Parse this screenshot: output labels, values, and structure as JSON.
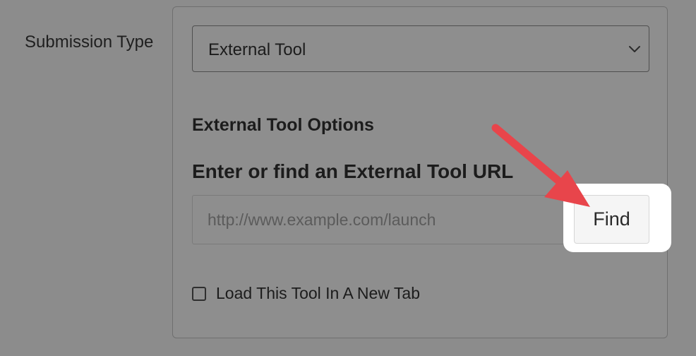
{
  "submission_type": {
    "label": "Submission Type",
    "selected": "External Tool"
  },
  "external_tool": {
    "options_heading": "External Tool Options",
    "url_heading": "Enter or find an External Tool URL",
    "url_placeholder": "http://www.example.com/launch",
    "url_value": "",
    "find_button": "Find",
    "new_tab_label": "Load This Tool In A New Tab",
    "new_tab_checked": false
  },
  "annotation": {
    "arrow_color": "#e8454b",
    "highlight_color": "#ffffff"
  }
}
